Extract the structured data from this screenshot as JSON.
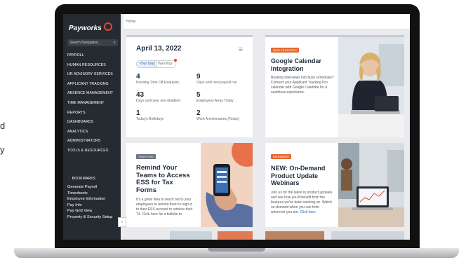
{
  "side_text": [
    "d",
    "y"
  ],
  "sidebar": {
    "logo": "Payworks",
    "search_placeholder": "Search Navigation...",
    "menu": [
      "PAYROLL",
      "HUMAN RESOURCES",
      "HR ADVISORY SERVICES",
      "APPLICANT TRACKING",
      "ABSENCE MANAGEMENT",
      "TIME MANAGEMENT",
      "REPORTS",
      "DASHBOARDS",
      "ANALYTICS",
      "ADMINISTRATORS",
      "TOOLS & RESOURCES"
    ],
    "bookmarks_label": "BOOKMARKS",
    "bookmarks": [
      "Generate Payroll",
      "Timesheets",
      "Employee Information",
      "Pay Info",
      "Pay Grid View",
      "Property & Security Setup"
    ]
  },
  "breadcrumb": "Home",
  "date_card": {
    "date": "April 13, 2022",
    "tabs": [
      "Your Day",
      "Warnings"
    ],
    "stats": [
      {
        "value": "4",
        "label": "Pending Time Off Requests"
      },
      {
        "value": "9",
        "label": "Days until next payroll run"
      },
      {
        "value": "43",
        "label": "Days until year end deadline"
      },
      {
        "value": "5",
        "label": "Employees Away Today"
      },
      {
        "value": "1",
        "label": "Today's Birthdays"
      },
      {
        "value": "2",
        "label": "Work Anniversaries (Today)"
      }
    ]
  },
  "gcal_card": {
    "badge": "NEW FEATURES",
    "title": "Google Calendar Integration",
    "body": "Booking interviews into busy schedules? Connect your Applicant Tracking Pro calendar with Google Calendar for a seamless experience."
  },
  "essay_card": {
    "badge": "YEAR END",
    "title": "Remind Your Teams to Access ESS for Tax Forms",
    "body": "It's a great idea to reach out to your employees to remind them to sign in to their ESS account to retrieve their T4. Click here for a bulletin to"
  },
  "webinar_card": {
    "badge": "WEBINARS",
    "title": "NEW: On-Demand Product Update Webinars",
    "body": "Join us for the latest in product updates and see how you'll benefit from the features we've been working on. Watch on-demand when you can from wherever you are.",
    "link": "Click here."
  },
  "colors": {
    "accent": "#e8452c",
    "sidebar": "#262a31",
    "badge_orange": "#e8682c",
    "badge_gray": "#6b7280"
  }
}
